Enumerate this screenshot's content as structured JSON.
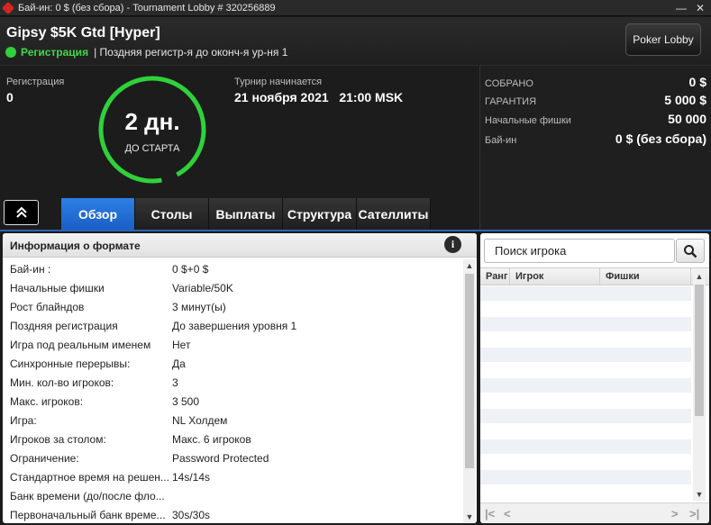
{
  "window": {
    "title": "Бай-ин: 0 $ (без сбора) - Tournament Lobby # 320256889",
    "minimize_glyph": "—",
    "close_glyph": "✕"
  },
  "header": {
    "tournament_name": "Gipsy $5K Gtd [Hyper]",
    "status": "Регистрация",
    "status_note": "| Поздняя регистр-я до оконч-я ур-ня 1",
    "status_color": "#2fd13a",
    "lobby_button": "Poker Lobby"
  },
  "info": {
    "registration_label": "Регистрация",
    "registration_value": "0",
    "countdown_value": "2 дн.",
    "countdown_label": "ДО СТАРТА",
    "countdown_ring_color": "#2fd13a",
    "start_label": "Турнир начинается",
    "start_value": "21 ноября 2021   21:00 MSK"
  },
  "prize": {
    "rows": [
      {
        "label": "СОБРАНО",
        "value": "0 $"
      },
      {
        "label": "ГАРАНТИЯ",
        "value": "5 000 $"
      },
      {
        "label": "Начальные фишки",
        "value": "50 000"
      },
      {
        "label": "Бай-ин",
        "value": "0 $ (без сбора)"
      }
    ]
  },
  "tabs": {
    "items": [
      {
        "label": "Обзор",
        "active": true
      },
      {
        "label": "Столы",
        "active": false
      },
      {
        "label": "Выплаты",
        "active": false
      },
      {
        "label": "Структура",
        "active": false
      },
      {
        "label": "Сателлиты",
        "active": false
      }
    ],
    "active_color": "#1f6ed8"
  },
  "format": {
    "title": "Информация о формате",
    "info_glyph": "i",
    "rows": [
      {
        "key": "Бай-ин :",
        "value": "0 $+0 $"
      },
      {
        "key": "Начальные фишки",
        "value": "Variable/50K"
      },
      {
        "key": "Рост блайндов",
        "value": "3 минут(ы)"
      },
      {
        "key": "Поздняя регистрация",
        "value": "До завершения уровня 1"
      },
      {
        "key": "Игра под реальным именем",
        "value": "Нет"
      },
      {
        "key": "Синхронные перерывы:",
        "value": "Да"
      },
      {
        "key": "Мин. кол-во игроков:",
        "value": "3"
      },
      {
        "key": "Макс. игроков:",
        "value": "3 500"
      },
      {
        "key": "Игра:",
        "value": "NL Холдем"
      },
      {
        "key": "Игроков за столом:",
        "value": "Макс. 6 игроков"
      },
      {
        "key": "Ограничение:",
        "value": "Password Protected"
      },
      {
        "key": "Стандартное время на решен...",
        "value": "14s/14s"
      },
      {
        "key": "Банк времени (до/после фло...",
        "value": ""
      },
      {
        "key": "Первоначальный банк време...",
        "value": "30s/30s"
      }
    ]
  },
  "players": {
    "search_placeholder": "Поиск игрока",
    "columns": [
      "Ранг",
      "Игрок",
      "Фишки"
    ],
    "pager": {
      "first": "|<",
      "prev": "<",
      "next": ">",
      "last": ">|"
    }
  }
}
